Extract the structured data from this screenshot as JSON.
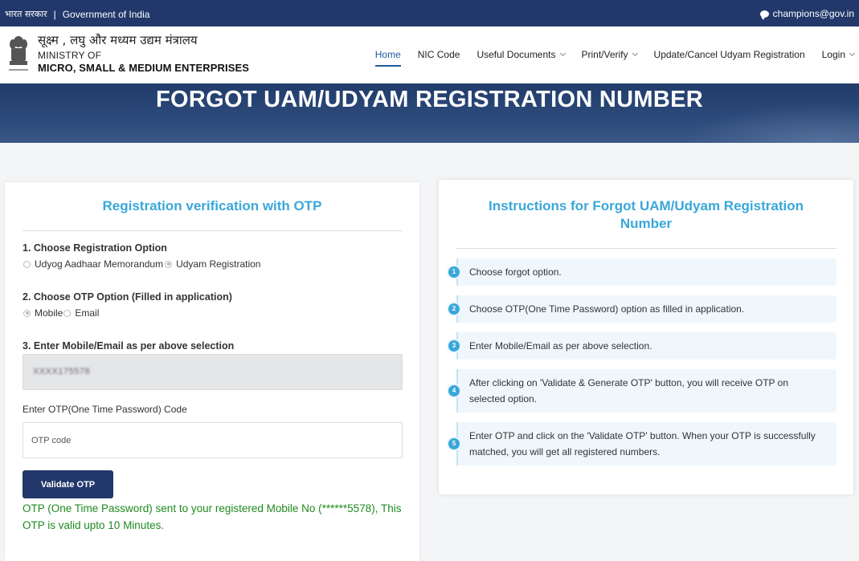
{
  "topbar": {
    "hindi_gov": "भारत सरकार",
    "separator": "|",
    "gov_of_india": "Government of India",
    "email": "champions@gov.in"
  },
  "header": {
    "ministry_hindi": "सूक्ष्म , लघु और मध्यम उद्यम मंत्रालय",
    "ministry_line2": "MINISTRY OF",
    "ministry_line3": "MICRO, SMALL & MEDIUM ENTERPRISES",
    "nav": [
      {
        "label": "Home",
        "active": true,
        "dropdown": false
      },
      {
        "label": "NIC Code",
        "active": false,
        "dropdown": false
      },
      {
        "label": "Useful Documents",
        "active": false,
        "dropdown": true
      },
      {
        "label": "Print/Verify",
        "active": false,
        "dropdown": true
      },
      {
        "label": "Update/Cancel Udyam Registration",
        "active": false,
        "dropdown": false
      },
      {
        "label": "Login",
        "active": false,
        "dropdown": true
      }
    ]
  },
  "banner": {
    "title": "FORGOT UAM/UDYAM REGISTRATION NUMBER"
  },
  "form": {
    "title": "Registration verification with OTP",
    "step1_label": "1. Choose Registration Option",
    "reg_options": [
      {
        "label": "Udyog Aadhaar Memorandum",
        "checked": false
      },
      {
        "label": "Udyam Registration",
        "checked": true
      }
    ],
    "step2_label": "2. Choose OTP Option (Filled in application)",
    "otp_options": [
      {
        "label": "Mobile",
        "checked": true
      },
      {
        "label": "Email",
        "checked": false
      }
    ],
    "step3_label": "3. Enter Mobile/Email as per above selection",
    "mobile_value": "XXXX175578",
    "otp_label": "Enter OTP(One Time Password) Code",
    "otp_placeholder": "OTP code",
    "validate_button": "Validate OTP",
    "otp_message": "OTP (One Time Password) sent to your registered Mobile No (******5578), This OTP is valid upto 10 Minutes."
  },
  "instructions": {
    "title": "Instructions for Forgot UAM/Udyam Registration Number",
    "steps": [
      {
        "num": "1",
        "text": "Choose forgot option."
      },
      {
        "num": "2",
        "text": "Choose OTP(One Time Password) option as filled in application."
      },
      {
        "num": "3",
        "text": "Enter Mobile/Email as per above selection."
      },
      {
        "num": "4",
        "text": "After clicking on 'Validate & Generate OTP' button, you will receive OTP on selected option."
      },
      {
        "num": "5",
        "text": "Enter OTP and click on the 'Validate OTP' button. When your OTP is successfully matched, you will get all registered numbers."
      }
    ]
  },
  "colors": {
    "navy": "#22386a",
    "accent_blue": "#3aa7d9",
    "success_green": "#1f8a1f"
  }
}
